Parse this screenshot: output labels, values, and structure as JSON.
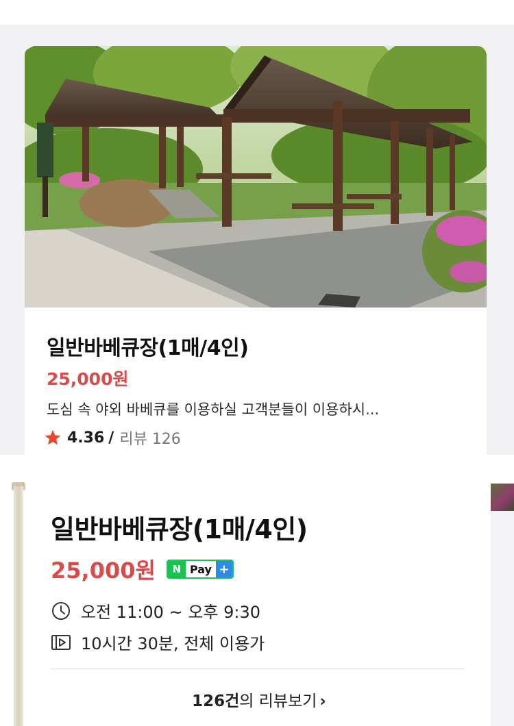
{
  "listing_card": {
    "title": "일반바베큐장(1매/4인)",
    "price": "25,000원",
    "description": "도심 속 야외 바베큐를 이용하실 고객분들이 이용하시...",
    "rating": "4.36",
    "rating_separator": "/",
    "review_label": "리뷰 126",
    "star_icon": "star-icon",
    "star_color": "#e8452d"
  },
  "detail_card": {
    "title": "일반바베큐장(1매/4인)",
    "price": "25,000원",
    "npay_badge": {
      "n": "N",
      "text": "Pay",
      "plus": "+"
    },
    "hours": "오전 11:00 ~ 오후 9:30",
    "duration": "10시간 30분, 전체 이용가",
    "review_count": "126건",
    "review_suffix": "의 리뷰보기",
    "review_chevron": "›"
  },
  "colors": {
    "price": "#d94a4a",
    "npay_green": "#19c34f",
    "npay_blue": "#2d8ce8"
  }
}
